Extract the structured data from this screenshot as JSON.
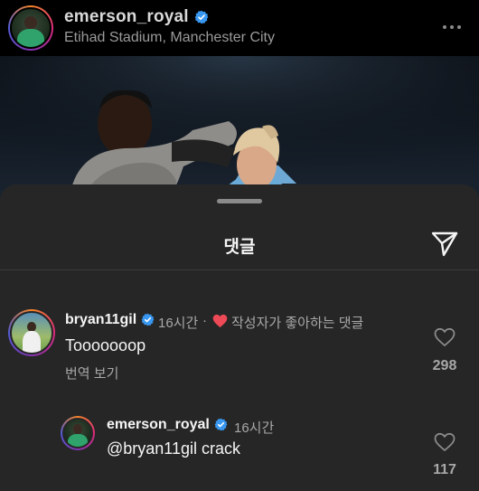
{
  "post": {
    "username": "emerson_royal",
    "location": "Etihad Stadium, Manchester City",
    "verified_icon": "verified-badge-icon",
    "more_icon": "more-horizontal-icon"
  },
  "sheet": {
    "title": "댓글",
    "share_icon": "send-icon"
  },
  "comments": [
    {
      "username": "bryan11gil",
      "time": "16시간",
      "separator": "·",
      "liked_by_author": "작성자가 좋아하는 댓글",
      "text": "Tooooooop",
      "translate": "번역 보기",
      "likes": "298"
    },
    {
      "username": "emerson_royal",
      "time": "16시간",
      "text": "@bryan11gil crack",
      "likes": "117"
    }
  ],
  "colors": {
    "background": "#000000",
    "sheet": "#262626",
    "verified": "#3897f0",
    "heart_red": "#ed4956",
    "secondary_text": "#a8a8a8"
  }
}
